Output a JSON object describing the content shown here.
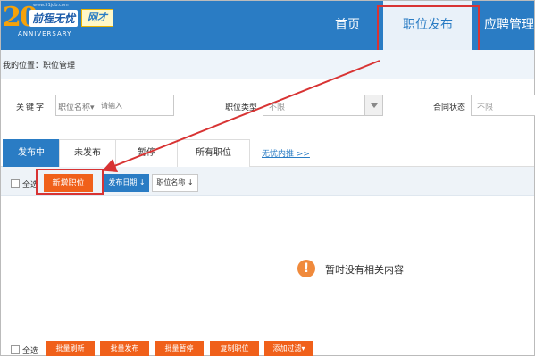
{
  "header": {
    "logo": {
      "year_mark": "20",
      "url": "www.51job.com",
      "brand": "前程无忧",
      "tag": "网才",
      "anniversary": "ANNIVERSARY"
    },
    "nav": [
      "首页",
      "职位发布",
      "应聘管理"
    ]
  },
  "breadcrumb": "我的位置：职位管理",
  "filters": {
    "keyword_label": "关键字",
    "keyword_type": "职位名称▾",
    "keyword_placeholder": "请输入",
    "type_label": "职位类型",
    "type_value": "不限",
    "status_label": "合同状态",
    "status_value": "不限"
  },
  "tabs": [
    "发布中",
    "未发布",
    "暂停",
    "所有职位"
  ],
  "tab_link": "无忧内推 >>",
  "toolbar": {
    "select_all": "全选",
    "new_job": "新增职位",
    "sort_date": "发布日期 ↓",
    "sort_name": "职位名称 ↓"
  },
  "empty": {
    "icon": "!",
    "text": "暂时没有相关内容"
  },
  "bottom_bar": {
    "select_all": "全选",
    "buttons": [
      "批量刷新",
      "批量发布",
      "批量暂停",
      "复制职位",
      "添加过滤▾"
    ]
  },
  "colors": {
    "header_blue": "#2a7cc4",
    "action_orange": "#f0601a",
    "highlight_red": "#d83333"
  }
}
